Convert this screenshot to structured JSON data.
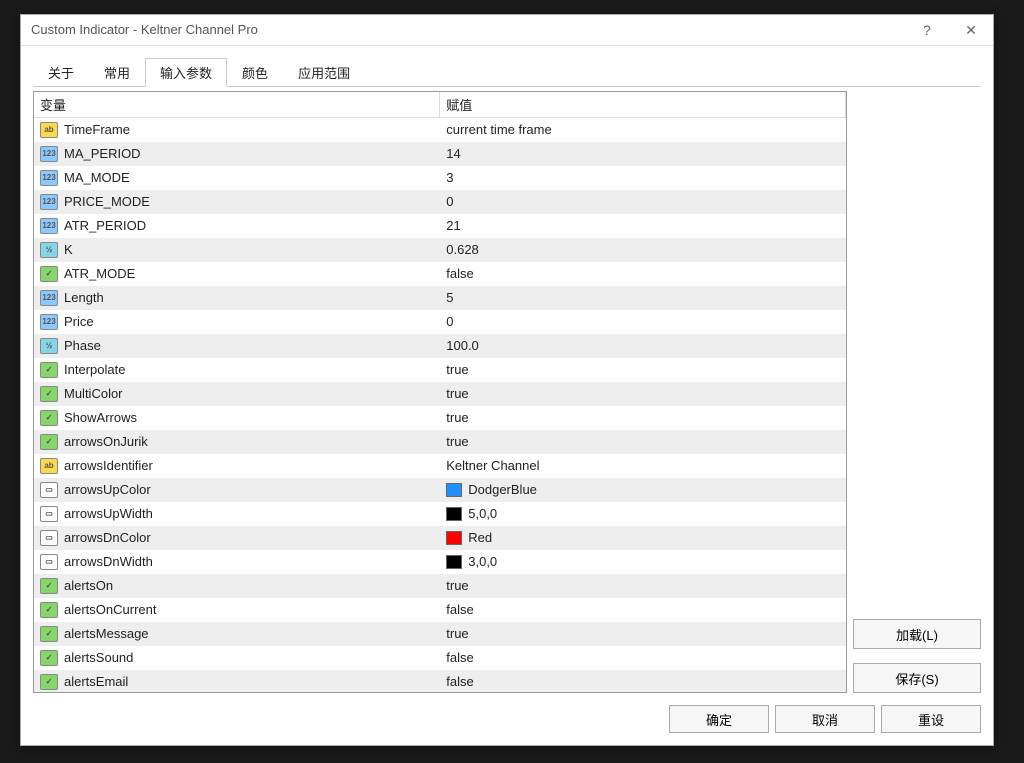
{
  "title": "Custom Indicator - Keltner Channel Pro",
  "tabs": [
    "关于",
    "常用",
    "输入参数",
    "颜色",
    "应用范围"
  ],
  "active_tab": 2,
  "columns": {
    "var": "变量",
    "value": "赋值"
  },
  "rows": [
    {
      "icon": "ab",
      "name": "TimeFrame",
      "value": "current time frame"
    },
    {
      "icon": "123",
      "name": "MA_PERIOD",
      "value": "14"
    },
    {
      "icon": "123",
      "name": "MA_MODE",
      "value": "3"
    },
    {
      "icon": "123",
      "name": "PRICE_MODE",
      "value": "0"
    },
    {
      "icon": "123",
      "name": "ATR_PERIOD",
      "value": "21"
    },
    {
      "icon": "v2",
      "name": "K",
      "value": "0.628"
    },
    {
      "icon": "bool",
      "name": "ATR_MODE",
      "value": "false"
    },
    {
      "icon": "123",
      "name": "Length",
      "value": "5"
    },
    {
      "icon": "123",
      "name": "Price",
      "value": "0"
    },
    {
      "icon": "v2",
      "name": "Phase",
      "value": "100.0"
    },
    {
      "icon": "bool",
      "name": "Interpolate",
      "value": "true"
    },
    {
      "icon": "bool",
      "name": "MultiColor",
      "value": "true"
    },
    {
      "icon": "bool",
      "name": "ShowArrows",
      "value": "true"
    },
    {
      "icon": "bool",
      "name": "arrowsOnJurik",
      "value": "true"
    },
    {
      "icon": "ab",
      "name": "arrowsIdentifier",
      "value": "Keltner Channel"
    },
    {
      "icon": "color",
      "name": "arrowsUpColor",
      "value": "DodgerBlue",
      "swatch": "#1e90ff"
    },
    {
      "icon": "color",
      "name": "arrowsUpWidth",
      "value": "5,0,0",
      "swatch": "#000000"
    },
    {
      "icon": "color",
      "name": "arrowsDnColor",
      "value": "Red",
      "swatch": "#ff0000"
    },
    {
      "icon": "color",
      "name": "arrowsDnWidth",
      "value": "3,0,0",
      "swatch": "#000000"
    },
    {
      "icon": "bool",
      "name": "alertsOn",
      "value": "true"
    },
    {
      "icon": "bool",
      "name": "alertsOnCurrent",
      "value": "false"
    },
    {
      "icon": "bool",
      "name": "alertsMessage",
      "value": "true"
    },
    {
      "icon": "bool",
      "name": "alertsSound",
      "value": "false"
    },
    {
      "icon": "bool",
      "name": "alertsEmail",
      "value": "false"
    }
  ],
  "buttons": {
    "load": "加载(L)",
    "save": "保存(S)",
    "ok": "确定",
    "cancel": "取消",
    "reset": "重设"
  }
}
